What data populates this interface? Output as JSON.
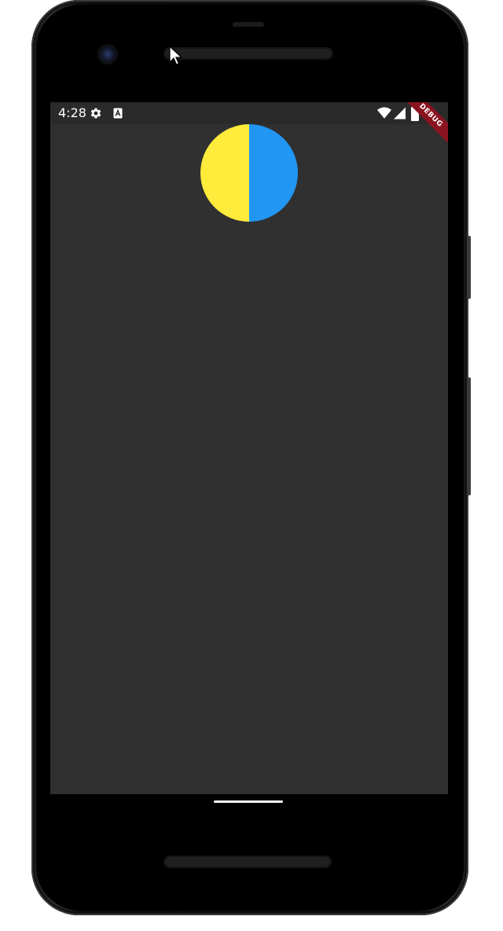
{
  "status_bar": {
    "time": "4:28",
    "icons": [
      "gear-icon",
      "sim-a-icon",
      "wifi-icon",
      "cellular-signal-icon",
      "battery-icon"
    ]
  },
  "debug_banner": {
    "label": "DEBUG"
  },
  "pie_widget": {
    "segments": [
      {
        "color": "#FFEB3B",
        "fraction": 0.5
      },
      {
        "color": "#2196F3",
        "fraction": 0.5
      }
    ]
  },
  "colors": {
    "screen_background": "#303030",
    "status_bar_background": "#2a2a2a",
    "debug_banner": "#8a1320"
  }
}
